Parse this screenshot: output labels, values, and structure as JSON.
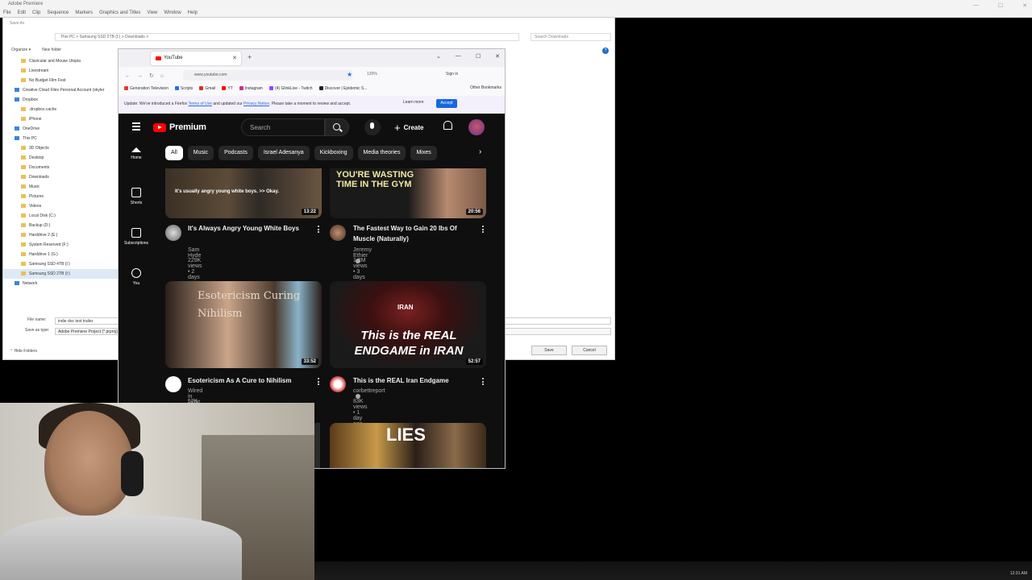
{
  "premiere": {
    "title": "Adobe Premiere",
    "menu": [
      "File",
      "Edit",
      "Clip",
      "Sequence",
      "Markers",
      "Graphics and Titles",
      "View",
      "Window",
      "Help"
    ]
  },
  "save_dialog": {
    "title": "Save As",
    "path": "This PC  >  Samsung SSD 2TB (I:)  >  Downloads  >",
    "search_placeholder": "Search Downloads",
    "organize": "Organize ▾",
    "new_folder": "New folder",
    "tree": [
      {
        "label": "Clavicular and Mouse Utopia",
        "kind": "folder"
      },
      {
        "label": "Livestream",
        "kind": "folder"
      },
      {
        "label": "No Budget Film Fest",
        "kind": "folder"
      },
      {
        "label": "Creative Cloud Files Personal Account (skyler",
        "kind": "cloud"
      },
      {
        "label": "Dropbox",
        "kind": "cloud"
      },
      {
        "label": ".dropbox.cache",
        "kind": "folder"
      },
      {
        "label": "iPhone",
        "kind": "folder"
      },
      {
        "label": "OneDrive",
        "kind": "cloud"
      },
      {
        "label": "This PC",
        "kind": "pc"
      },
      {
        "label": "3D Objects",
        "kind": "folder"
      },
      {
        "label": "Desktop",
        "kind": "folder"
      },
      {
        "label": "Documents",
        "kind": "folder"
      },
      {
        "label": "Downloads",
        "kind": "folder"
      },
      {
        "label": "Music",
        "kind": "folder"
      },
      {
        "label": "Pictures",
        "kind": "folder"
      },
      {
        "label": "Videos",
        "kind": "folder"
      },
      {
        "label": "Local Disk (C:)",
        "kind": "drive"
      },
      {
        "label": "Backup (D:)",
        "kind": "drive"
      },
      {
        "label": "Harddrive 2 (E:)",
        "kind": "drive"
      },
      {
        "label": "System Reserved (F:)",
        "kind": "drive"
      },
      {
        "label": "Harddrive 1 (G:)",
        "kind": "drive"
      },
      {
        "label": "Samsung SSD 4TB (I:)",
        "kind": "drive"
      },
      {
        "label": "Samsung SSD 2TB (I:)",
        "kind": "drive-selected"
      },
      {
        "label": "Network",
        "kind": "network"
      }
    ],
    "file_name_label": "File name:",
    "file_name_value": "indie doc test trailer",
    "save_type_label": "Save as type:",
    "save_type_value": "Adobe Premiere Project (*.prproj)",
    "hide_folders": "Hide Folders",
    "save": "Save",
    "cancel": "Cancel"
  },
  "firefox": {
    "tab_title": "YouTube",
    "url": "www.youtube.com",
    "search_placeholder": "Search",
    "zoom": "120%",
    "sign_in": "Sign in",
    "bookmarks": [
      {
        "label": "Generation Television",
        "color": "#e33"
      },
      {
        "label": "Scripts",
        "color": "#2a6fdb"
      },
      {
        "label": "Gmail",
        "color": "#d93025"
      },
      {
        "label": "YT",
        "color": "#f00"
      },
      {
        "label": "Instagram",
        "color": "#c13584"
      },
      {
        "label": "(4) GlinkLive - Twitch",
        "color": "#9146ff"
      },
      {
        "label": "Discover | Epidemic S...",
        "color": "#222"
      }
    ],
    "other_bookmarks": "Other Bookmarks",
    "notice": {
      "text_before": "Update: We've introduced a Firefox ",
      "terms": "Terms of Use",
      "text_mid": " and updated our ",
      "privacy": "Privacy Notice",
      "text_after": ". Please take a moment to review and accept.",
      "learn_more": "Learn more",
      "accept": "Accept"
    }
  },
  "youtube": {
    "logo": "Premium",
    "search_placeholder": "Search",
    "create": "Create",
    "chips": [
      "All",
      "Music",
      "Podcasts",
      "Israel Adesanya",
      "Kickboxing",
      "Media theories",
      "Mixes"
    ],
    "guide": [
      "Home",
      "Shorts",
      "Subscriptions",
      "You"
    ],
    "videos": [
      {
        "title": "It's Always Angry Young White Boys",
        "channel": "Sam Hyde",
        "meta": "229K views • 2 days ago",
        "duration": "13:22",
        "thumb_caption": "It's usually angry young white boys. >> Okay."
      },
      {
        "title": "The Fastest Way to Gain 20 lbs Of Muscle (Naturally)",
        "channel": "Jeremy Ethier",
        "meta": "1.2M views • 3 days ago",
        "duration": "20:56",
        "thumb_caption": "YOU'RE WASTING TIME IN THE GYM"
      },
      {
        "title": "Esotericism As A Cure to Nihilism",
        "channel": "Wired in Light",
        "meta": "57K views • 3 days ago",
        "duration": "33:52",
        "thumb_caption": "Esotericism Curing Nihilism"
      },
      {
        "title": "This is the REAL Iran Endgame",
        "channel": "corbettreport",
        "meta": "83K views • 1 day ago",
        "duration": "52:57",
        "thumb_caption_a": "IRAN",
        "thumb_caption_b": "This is the REAL ENDGAME in IRAN"
      },
      {
        "thumb_caption": "LIES"
      }
    ]
  },
  "clock": "12:31 AM"
}
